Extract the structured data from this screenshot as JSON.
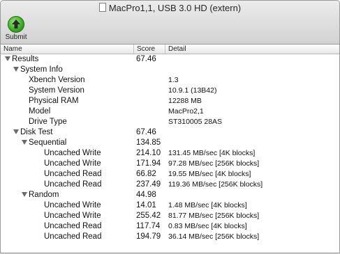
{
  "window": {
    "title": "MacPro1,1, USB 3.0 HD (extern)"
  },
  "toolbar": {
    "submit_label": "Submit"
  },
  "columns": {
    "name": "Name",
    "score": "Score",
    "detail": "Detail"
  },
  "rows": [
    {
      "name": "Results",
      "level": 0,
      "expanded": true,
      "score": "67.46",
      "detail": ""
    },
    {
      "name": "System Info",
      "level": 1,
      "expanded": true,
      "score": "",
      "detail": ""
    },
    {
      "name": "Xbench Version",
      "level": 2,
      "expanded": null,
      "score": "",
      "detail": "1.3"
    },
    {
      "name": "System Version",
      "level": 2,
      "expanded": null,
      "score": "",
      "detail": "10.9.1 (13B42)"
    },
    {
      "name": "Physical RAM",
      "level": 2,
      "expanded": null,
      "score": "",
      "detail": "12288 MB"
    },
    {
      "name": "Model",
      "level": 2,
      "expanded": null,
      "score": "",
      "detail": "MacPro2,1"
    },
    {
      "name": "Drive Type",
      "level": 2,
      "expanded": null,
      "score": "",
      "detail": "ST310005 28AS"
    },
    {
      "name": "Disk Test",
      "level": 1,
      "expanded": true,
      "score": "67.46",
      "detail": ""
    },
    {
      "name": "Sequential",
      "level": 2,
      "expanded": true,
      "score": "134.85",
      "detail": ""
    },
    {
      "name": "Uncached Write",
      "level": 3,
      "expanded": null,
      "score": "214.10",
      "detail": "131.45 MB/sec [4K blocks]"
    },
    {
      "name": "Uncached Write",
      "level": 3,
      "expanded": null,
      "score": "171.94",
      "detail": "97.28 MB/sec [256K blocks]"
    },
    {
      "name": "Uncached Read",
      "level": 3,
      "expanded": null,
      "score": "66.82",
      "detail": "19.55 MB/sec [4K blocks]"
    },
    {
      "name": "Uncached Read",
      "level": 3,
      "expanded": null,
      "score": "237.49",
      "detail": "119.36 MB/sec [256K blocks]"
    },
    {
      "name": "Random",
      "level": 2,
      "expanded": true,
      "score": "44.98",
      "detail": ""
    },
    {
      "name": "Uncached Write",
      "level": 3,
      "expanded": null,
      "score": "14.01",
      "detail": "1.48 MB/sec [4K blocks]"
    },
    {
      "name": "Uncached Write",
      "level": 3,
      "expanded": null,
      "score": "255.42",
      "detail": "81.77 MB/sec [256K blocks]"
    },
    {
      "name": "Uncached Read",
      "level": 3,
      "expanded": null,
      "score": "117.74",
      "detail": "0.83 MB/sec [4K blocks]"
    },
    {
      "name": "Uncached Read",
      "level": 3,
      "expanded": null,
      "score": "194.79",
      "detail": "36.14 MB/sec [256K blocks]"
    }
  ],
  "icons": {
    "submit": "submit-arrow-up-icon",
    "disclosure": "disclosure-triangle-icon",
    "document": "document-proxy-icon"
  },
  "colors": {
    "submit_green": "#3fae2a"
  }
}
